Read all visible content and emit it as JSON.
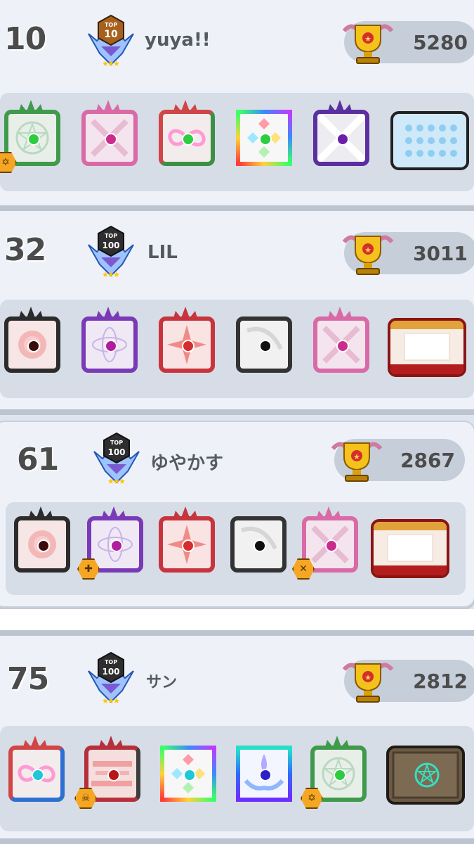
{
  "players": [
    {
      "rank": "10",
      "rank_badge": {
        "top": "TOP",
        "num": "10",
        "tier": "bronze"
      },
      "name": "yuya!!",
      "trophy_icon": "trophy-icon",
      "score": "5280",
      "decks": [
        {
          "icon": "pentagram-frame-icon",
          "frame": "#3f9a4b",
          "bg": "#e8efe9",
          "dot": "#2ecc40",
          "hex": "✡"
        },
        {
          "icon": "sword-frame-icon",
          "frame": "#d96aa7",
          "bg": "#f4e4ee",
          "dot": "#cc2b8e"
        },
        {
          "icon": "infinity-frame-icon",
          "frame": "#d04545",
          "bg": "#f3ecec",
          "dot": "#2ecc40"
        },
        {
          "icon": "rainbow-diamond-icon",
          "frame": "#b35cff",
          "bg": "#f7f7f7",
          "dot": "#2ecc40"
        },
        {
          "icon": "burst-frame-icon",
          "frame": "#5a2fa0",
          "bg": "#ececf1",
          "dot": "#6b1fa8"
        },
        {
          "icon": "cloud-board-icon",
          "wide": true,
          "bg": "#cfe9f8"
        }
      ]
    },
    {
      "rank": "32",
      "rank_badge": {
        "top": "TOP",
        "num": "100",
        "tier": "silver"
      },
      "name": "LIL",
      "trophy_icon": "trophy-icon",
      "score": "3011",
      "decks": [
        {
          "icon": "rose-frame-icon",
          "frame": "#2b2b2b",
          "bg": "#f6e6e6",
          "dot": "#3b0a0a"
        },
        {
          "icon": "atom-frame-icon",
          "frame": "#7a3ab7",
          "bg": "#efe9f5",
          "dot": "#b01e9d"
        },
        {
          "icon": "compass-frame-icon",
          "frame": "#c8343d",
          "bg": "#f9e3e3",
          "dot": "#d52d2d"
        },
        {
          "icon": "scythe-frame-icon",
          "frame": "#333333",
          "bg": "#f1f1f1",
          "dot": "#111111"
        },
        {
          "icon": "sword-frame-icon",
          "frame": "#d96aa7",
          "bg": "#f4e4ee",
          "dot": "#cc2b8e"
        },
        {
          "icon": "royal-board-icon",
          "wide": true,
          "bg": "#f7ece4"
        }
      ]
    },
    {
      "rank": "61",
      "rank_badge": {
        "top": "TOP",
        "num": "100",
        "tier": "silver"
      },
      "name": "ゆやかす",
      "trophy_icon": "trophy-icon",
      "score": "2867",
      "decks": [
        {
          "icon": "rose-frame-icon",
          "frame": "#2b2b2b",
          "bg": "#f6e6e6",
          "dot": "#3b0a0a"
        },
        {
          "icon": "atom-frame-icon",
          "frame": "#7a3ab7",
          "bg": "#efe9f5",
          "dot": "#b01e9d",
          "hex": "✚"
        },
        {
          "icon": "compass-frame-icon",
          "frame": "#c8343d",
          "bg": "#f9e3e3",
          "dot": "#d52d2d"
        },
        {
          "icon": "scythe-frame-icon",
          "frame": "#333333",
          "bg": "#f1f1f1",
          "dot": "#111111"
        },
        {
          "icon": "sword-frame-icon",
          "frame": "#d96aa7",
          "bg": "#f4e4ee",
          "dot": "#cc2b8e",
          "hex": "✕"
        },
        {
          "icon": "royal-board-icon",
          "wide": true,
          "bg": "#f7ece4"
        }
      ]
    },
    {
      "rank": "75",
      "rank_badge": {
        "top": "TOP",
        "num": "100",
        "tier": "silver"
      },
      "name": "サン",
      "trophy_icon": "trophy-icon",
      "score": "2812",
      "decks": [
        {
          "icon": "infinity-frame-icon",
          "frame": "#d04545",
          "bg": "#f3ecec",
          "dot": "#1fc7d8"
        },
        {
          "icon": "glitch-frame-icon",
          "frame": "#b5303a",
          "bg": "#f5dede",
          "dot": "#b81818",
          "hex": "☠"
        },
        {
          "icon": "rainbow-diamond-icon",
          "frame": "#f0a63a",
          "bg": "#f7f7f7",
          "dot": "#1fc7d8"
        },
        {
          "icon": "flame-hands-icon",
          "frame": "#2f6bff",
          "bg": "#f3f6ff",
          "dot": "#2a21c9"
        },
        {
          "icon": "pentagram-frame-icon",
          "frame": "#3f9a4b",
          "bg": "#e8efe9",
          "dot": "#2ecc40",
          "hex": "✡"
        },
        {
          "icon": "dungeon-board-icon",
          "wide": true,
          "bg": "#6b5a44"
        }
      ]
    }
  ]
}
